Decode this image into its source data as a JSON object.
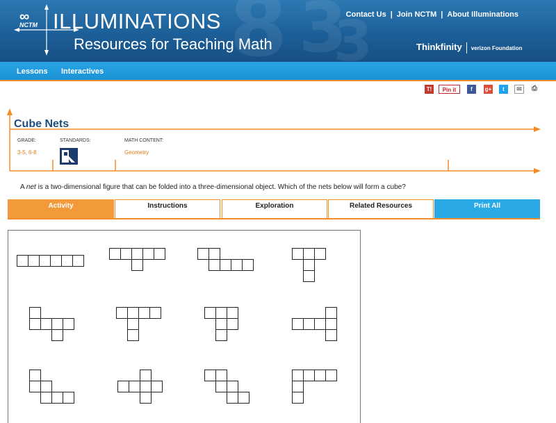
{
  "header": {
    "logo_small": "NCTM",
    "brand_title": "ILLUMINATIONS",
    "brand_subtitle": "Resources for Teaching Math",
    "top_links": [
      "Contact Us",
      "Join NCTM",
      "About Illuminations"
    ],
    "partner_name": "Thinkfinity",
    "partner_sub": "verizon Foundation",
    "bg_color": "#1c5f98"
  },
  "nav": {
    "items": [
      "Lessons",
      "Interactives"
    ],
    "bg_color": "#1992d6",
    "accent_color": "#f28c28"
  },
  "share_icons": [
    "tip-icon",
    "pinterest-icon",
    "facebook-icon",
    "google-plus-icon",
    "twitter-icon",
    "email-icon",
    "print-icon"
  ],
  "share_labels": {
    "pin": "Pin it",
    "tip": "T!"
  },
  "lesson": {
    "title": "Cube Nets",
    "grade_label": "GRADE:",
    "grade_value": "3-5, 6-8",
    "standards_label": "STANDARDS:",
    "content_label": "MATH CONTENT:",
    "content_value": "Geometry",
    "intro_prefix": "A ",
    "intro_em": "net",
    "intro_suffix": " is a two-dimensional figure that can be folded into a three-dimensional object. Which of the nets below will form a cube?"
  },
  "tabs": [
    {
      "label": "Activity",
      "active": true
    },
    {
      "label": "Instructions",
      "active": false
    },
    {
      "label": "Exploration",
      "active": false
    },
    {
      "label": "Related Resources",
      "active": false
    },
    {
      "label": "Print All",
      "active": false
    }
  ],
  "nets": [
    [
      [
        0,
        0
      ],
      [
        1,
        0
      ],
      [
        2,
        0
      ],
      [
        3,
        0
      ],
      [
        4,
        0
      ],
      [
        5,
        0
      ]
    ],
    [
      [
        0,
        0
      ],
      [
        1,
        0
      ],
      [
        2,
        0
      ],
      [
        3,
        0
      ],
      [
        4,
        0
      ],
      [
        2,
        1
      ]
    ],
    [
      [
        0,
        0
      ],
      [
        1,
        0
      ],
      [
        1,
        1
      ],
      [
        2,
        1
      ],
      [
        3,
        1
      ],
      [
        4,
        1
      ]
    ],
    [
      [
        0,
        0
      ],
      [
        1,
        0
      ],
      [
        2,
        0
      ],
      [
        1,
        1
      ],
      [
        1,
        2
      ],
      [
        0,
        0
      ]
    ],
    [
      [
        0,
        0
      ],
      [
        0,
        1
      ],
      [
        1,
        1
      ],
      [
        2,
        1
      ],
      [
        3,
        1
      ],
      [
        2,
        2
      ]
    ],
    [
      [
        0,
        0
      ],
      [
        1,
        0
      ],
      [
        2,
        0
      ],
      [
        3,
        0
      ],
      [
        1,
        1
      ],
      [
        1,
        2
      ]
    ],
    [
      [
        0,
        0
      ],
      [
        1,
        0
      ],
      [
        1,
        1
      ],
      [
        2,
        1
      ],
      [
        1,
        2
      ],
      [
        2,
        0
      ]
    ],
    [
      [
        0,
        1
      ],
      [
        1,
        1
      ],
      [
        2,
        1
      ],
      [
        3,
        1
      ],
      [
        3,
        0
      ],
      [
        3,
        2
      ]
    ],
    [
      [
        0,
        0
      ],
      [
        0,
        1
      ],
      [
        1,
        1
      ],
      [
        1,
        2
      ],
      [
        2,
        2
      ],
      [
        3,
        2
      ]
    ],
    [
      [
        2,
        0
      ],
      [
        2,
        1
      ],
      [
        1,
        1
      ],
      [
        0,
        1
      ],
      [
        3,
        1
      ],
      [
        2,
        2
      ]
    ],
    [
      [
        0,
        0
      ],
      [
        1,
        0
      ],
      [
        1,
        1
      ],
      [
        2,
        1
      ],
      [
        2,
        2
      ],
      [
        3,
        2
      ]
    ],
    [
      [
        0,
        0
      ],
      [
        0,
        1
      ],
      [
        0,
        2
      ],
      [
        1,
        0
      ],
      [
        2,
        0
      ],
      [
        3,
        0
      ]
    ]
  ]
}
